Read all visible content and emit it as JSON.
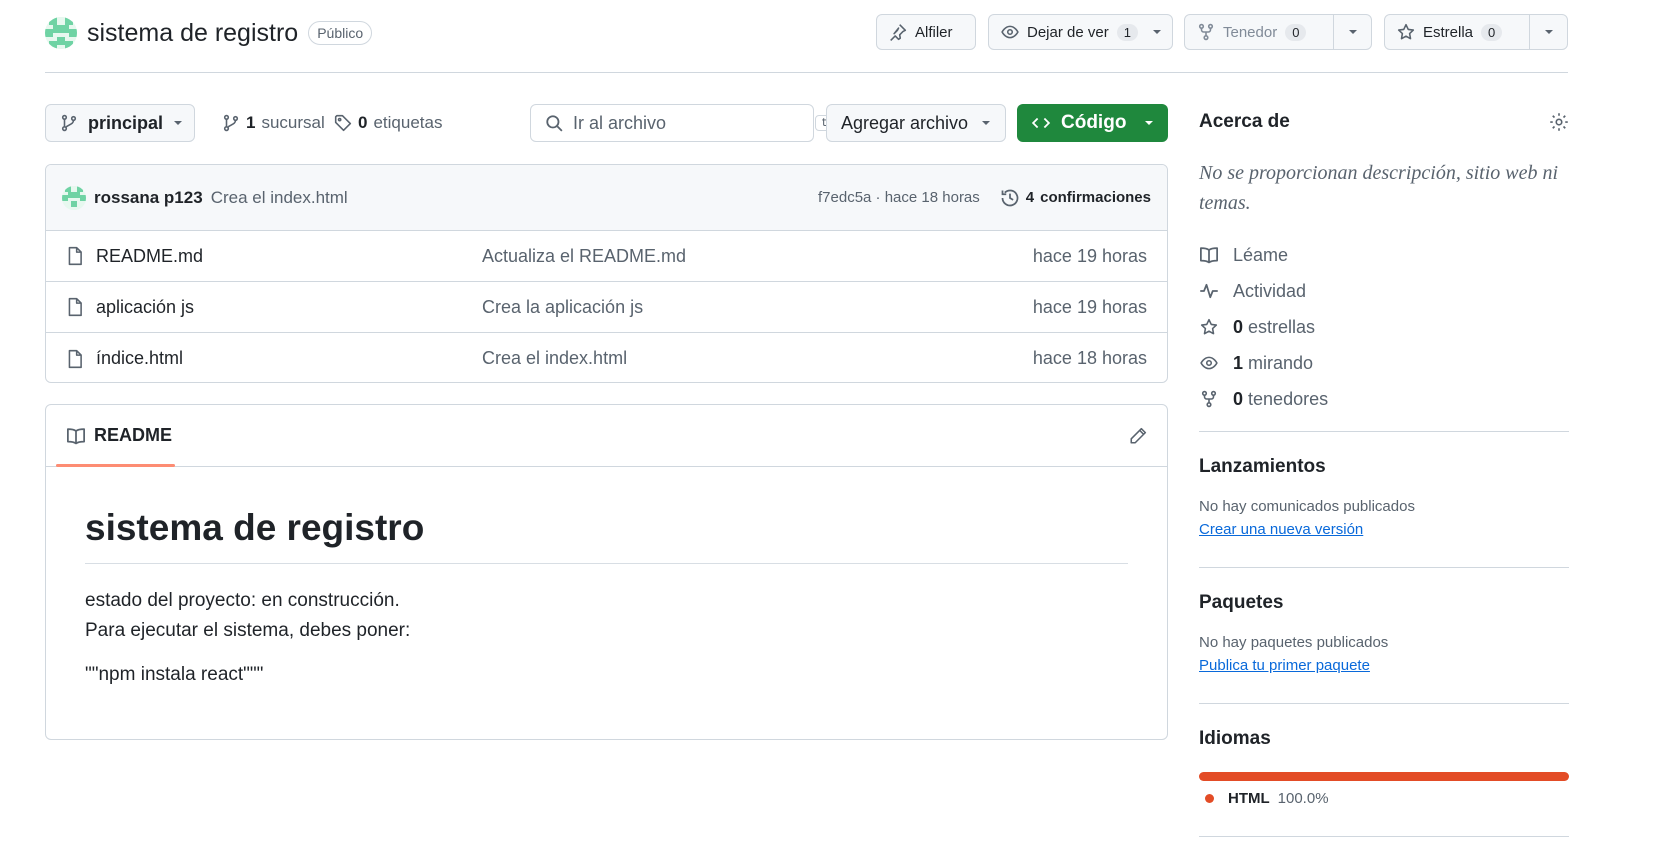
{
  "repo": {
    "name": "sistema de registro",
    "visibility": "Público"
  },
  "header_actions": {
    "pin": {
      "label": "Alfiler"
    },
    "watch": {
      "label": "Dejar de ver",
      "count": "1"
    },
    "fork": {
      "label": "Tenedor",
      "count": "0"
    },
    "star": {
      "label": "Estrella",
      "count": "0"
    }
  },
  "toolbar": {
    "branch": "principal",
    "branches_count": "1",
    "branches_label": "sucursal",
    "tags_count": "0",
    "tags_label": "etiquetas",
    "search_placeholder": "Ir al archivo",
    "search_shortcut": "t",
    "add_file": "Agregar archivo",
    "code": "Código"
  },
  "latest_commit": {
    "author": "rossana p123",
    "message": "Crea el index.html",
    "hash_time": "f7edc5a · hace 18 horas",
    "commits_count": "4",
    "commits_label": "confirmaciones"
  },
  "files": [
    {
      "name": "README.md",
      "message": "Actualiza el README.md",
      "date": "hace 19 horas"
    },
    {
      "name": "aplicación js",
      "message": "Crea la aplicación js",
      "date": "hace 19 horas"
    },
    {
      "name": "índice.html",
      "message": "Crea el index.html",
      "date": "hace 18 horas"
    }
  ],
  "readme": {
    "tab": "README",
    "title": "sistema de registro",
    "line1": "estado del proyecto: en construcción.",
    "line2": "Para ejecutar el sistema, debes poner:",
    "code": "\"\"npm instala react\"\"\""
  },
  "sidebar": {
    "about": {
      "heading": "Acerca de",
      "description": "No se proporcionan descripción, sitio web ni temas.",
      "items": [
        {
          "icon": "book-icon",
          "count": "",
          "label": "Léame"
        },
        {
          "icon": "pulse-icon",
          "count": "",
          "label": "Actividad"
        },
        {
          "icon": "star-icon",
          "count": "0",
          "label": "estrellas"
        },
        {
          "icon": "eye-icon",
          "count": "1",
          "label": "mirando"
        },
        {
          "icon": "fork-icon",
          "count": "0",
          "label": "tenedores"
        }
      ]
    },
    "releases": {
      "heading": "Lanzamientos",
      "empty": "No hay comunicados publicados",
      "link": "Crear una nueva versión"
    },
    "packages": {
      "heading": "Paquetes",
      "empty": "No hay paquetes publicados",
      "link": "Publica tu primer paquete"
    },
    "languages": {
      "heading": "Idiomas",
      "items": [
        {
          "name": "HTML",
          "percent": "100.0%",
          "fraction": 1.0,
          "color": "#e34c26"
        }
      ]
    }
  },
  "colors": {
    "accent_green": "#1f883d",
    "link_blue": "#0969da",
    "tab_underline": "#fd8c73"
  }
}
